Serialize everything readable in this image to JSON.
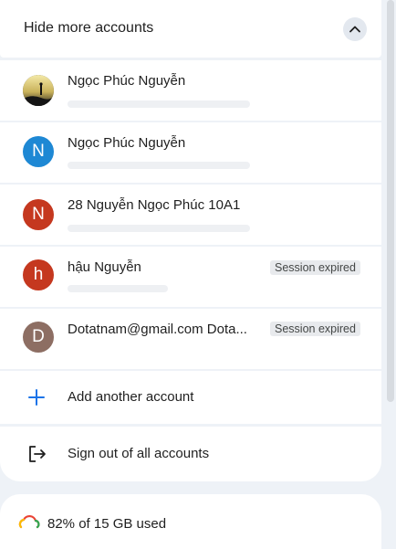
{
  "header": {
    "title": "Hide more accounts"
  },
  "accounts": [
    {
      "name": "Ngọc Phúc Nguyễn",
      "avatar_type": "photo",
      "avatar_letter": "",
      "avatar_color": "#2a2a2a",
      "status": ""
    },
    {
      "name": "Ngọc Phúc Nguyễn",
      "avatar_type": "letter",
      "avatar_letter": "N",
      "avatar_color": "#1e88d4",
      "status": ""
    },
    {
      "name": "28 Nguyễn Ngọc Phúc 10A1",
      "avatar_type": "letter",
      "avatar_letter": "N",
      "avatar_color": "#c5381f",
      "status": ""
    },
    {
      "name": "hậu Nguyễn",
      "avatar_type": "letter",
      "avatar_letter": "h",
      "avatar_color": "#c5381f",
      "status": "Session expired"
    },
    {
      "name": "Dotatnam@gmail.com Dota...",
      "avatar_type": "letter",
      "avatar_letter": "D",
      "avatar_color": "#8d6e63",
      "status": "Session expired"
    }
  ],
  "actions": {
    "add_account": "Add another account",
    "sign_out_all": "Sign out of all accounts"
  },
  "storage": {
    "text": "82% of 15 GB used"
  },
  "colors": {
    "background": "#eef2f7",
    "card": "#ffffff",
    "accent_blue": "#1a73e8"
  }
}
